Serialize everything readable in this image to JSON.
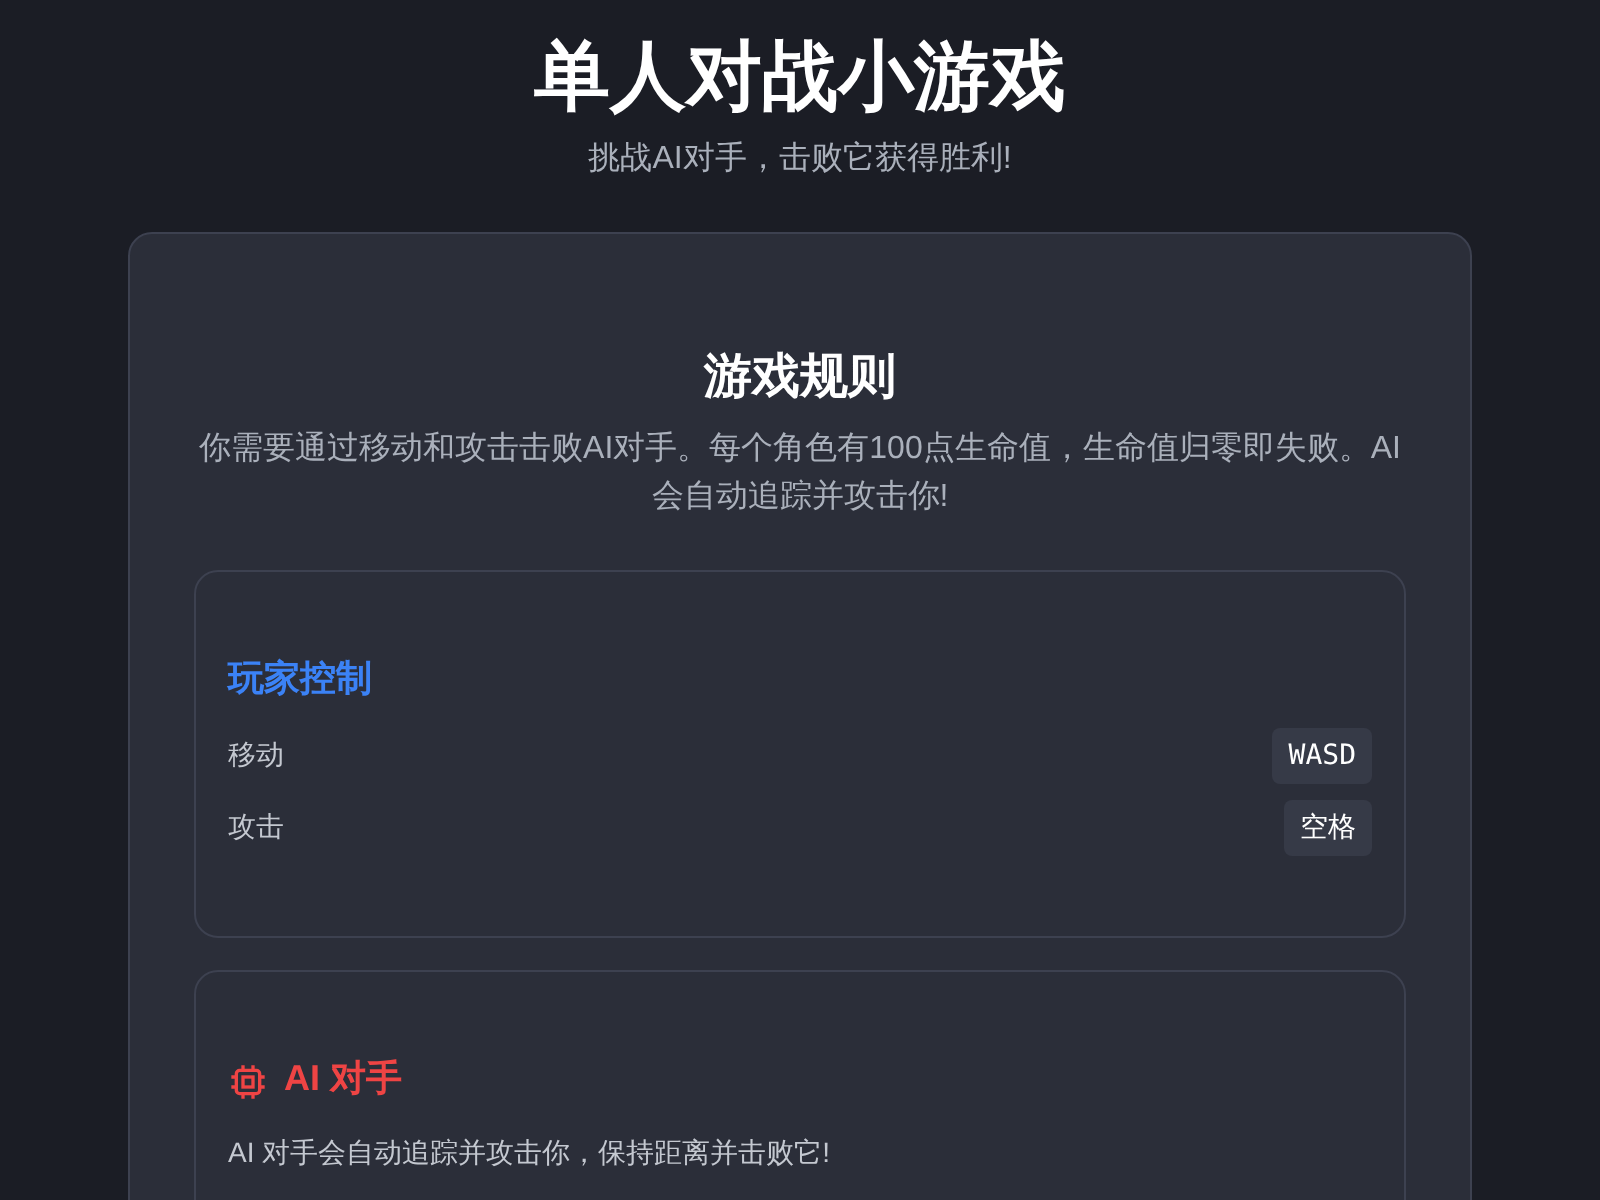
{
  "header": {
    "title": "单人对战小游戏",
    "subtitle": "挑战AI对手，击败它获得胜利!"
  },
  "rules": {
    "title": "游戏规则",
    "description": "你需要通过移动和攻击击败AI对手。每个角色有100点生命值，生命值归零即失败。AI会自动追踪并攻击你!",
    "sections": [
      {
        "kind": "controls",
        "title": "玩家控制",
        "color": "#3b82f6",
        "controls": [
          {
            "action": "移动",
            "key": "WASD"
          },
          {
            "action": "攻击",
            "key": "空格"
          }
        ]
      },
      {
        "kind": "opponent",
        "title": "AI 对手",
        "color": "#ef4444",
        "text": "AI 对手会自动追踪并攻击你，保持距离并击败它!"
      }
    ]
  }
}
